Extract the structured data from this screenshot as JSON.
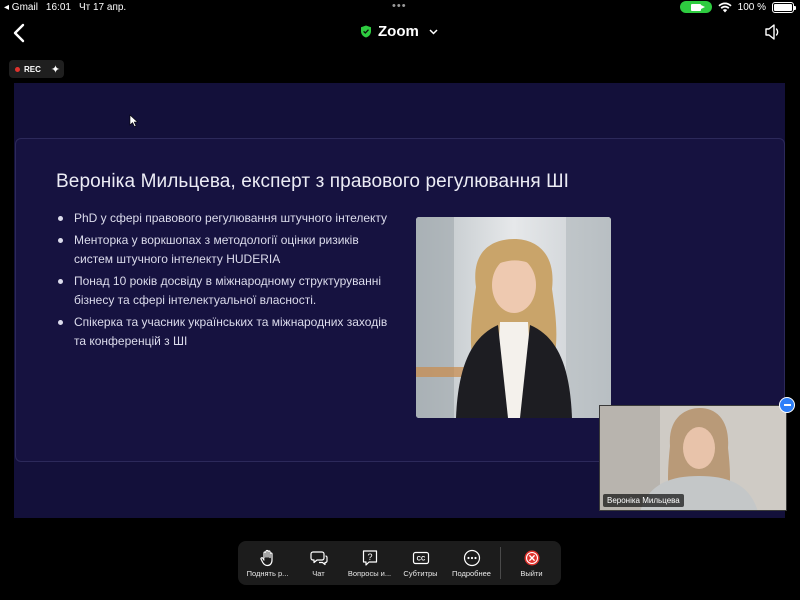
{
  "status_bar": {
    "back_app": "◂ Gmail",
    "time": "16:01",
    "date": "Чт 17 апр.",
    "dots": "•••",
    "battery": "100 %"
  },
  "topbar": {
    "title": "Zoom"
  },
  "rec_badge": {
    "label": "REC"
  },
  "slide": {
    "title": "Вероніка Мильцева, експерт з правового регулювання ШІ",
    "bullets": [
      "PhD у сфері правового регулювання штучного інтелекту",
      "Менторка у воркшопах з методології оцінки ризиків систем штучного інтелекту HUDERIA",
      "Понад 10 років досвіду в міжнародному структуруванні бізнесу та сфері інтелектуальної власності.",
      "Спікерка та учасник українських та міжнародних заходів та конференцій з ШІ"
    ]
  },
  "video_tile": {
    "name": "Вероніка Мильцева"
  },
  "toolbar": {
    "raise_hand": "Поднять р...",
    "chat": "Чат",
    "qa": "Вопросы и...",
    "captions": "Субтитры",
    "more": "Подробнее",
    "leave": "Выйти"
  },
  "colors": {
    "slide_bg": "#13103a",
    "card_bg": "#161240",
    "accent_green": "#2ecc40",
    "leave_red": "#e0322d",
    "collapse_blue": "#2d7ff9"
  }
}
